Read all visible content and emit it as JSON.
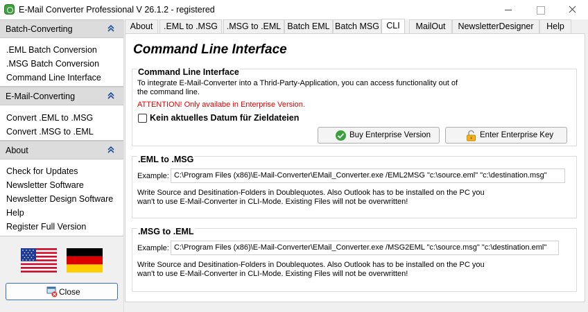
{
  "window": {
    "title": "E-Mail Converter Professional V 26.1.2 - registered"
  },
  "sidebar": {
    "sections": [
      {
        "title": "Batch-Converting",
        "items": [
          ".EML Batch Conversion",
          ".MSG Batch Conversion",
          "Command Line Interface"
        ]
      },
      {
        "title": "E-Mail-Converting",
        "items": [
          "Convert .EML to .MSG",
          "Convert .MSG to .EML"
        ]
      },
      {
        "title": "About",
        "items": [
          "Check for Updates",
          "Newsletter Software",
          "Newsletter Design Software",
          "Help",
          "Register Full Version"
        ]
      }
    ],
    "close_label": "Close"
  },
  "tabs": [
    "About",
    ".EML to .MSG",
    ".MSG to .EML",
    "Batch EML",
    "Batch MSG",
    "CLI",
    "MailOut",
    "NewsletterDesigner",
    "Help"
  ],
  "active_tab": "CLI",
  "main": {
    "heading": "Command Line Interface",
    "cli_group": {
      "title": "Command Line Interface",
      "desc_line1": "To integrate E-Mail-Converter into a Thrid-Party-Application, you can access functionality out of",
      "desc_line2": "the command line.",
      "attention": "ATTENTION! Only availabe in Enterprise Version.",
      "checkbox_label": "Kein aktuelles Datum für Zieldateien",
      "checkbox_checked": false,
      "buy_button": "Buy Enterprise Version",
      "key_button": "Enter Enterprise Key"
    },
    "eml_group": {
      "title": ".EML to .MSG",
      "example_label": "Example:",
      "example_value": "C:\\Program Files (x86)\\E-Mail-Converter\\EMail_Converter.exe /EML2MSG \"c:\\source.eml\" \"c:\\destination.msg\"",
      "note_line1": "Write Source and Desitination-Folders in Doublequotes. Also Outlook has to be installed on the PC you",
      "note_line2": "wan't to use E-Mail-Converter in CLI-Mode. Existing Files will not be overwritten!"
    },
    "msg_group": {
      "title": ".MSG to .EML",
      "example_label": "Example:",
      "example_value": "C:\\Program Files (x86)\\E-Mail-Converter\\EMail_Converter.exe /MSG2EML \"c:\\source.msg\" \"c:\\destination.eml\"",
      "note_line1": "Write Source and Desitination-Folders in Doublequotes. Also Outlook has to be installed on the PC you",
      "note_line2": "wan't to use E-Mail-Converter in CLI-Mode. Existing Files will not be overwritten!"
    }
  },
  "colors": {
    "attention": "#e00000",
    "app_icon": "#3c9e3c",
    "close_border": "#3b6fb6"
  }
}
